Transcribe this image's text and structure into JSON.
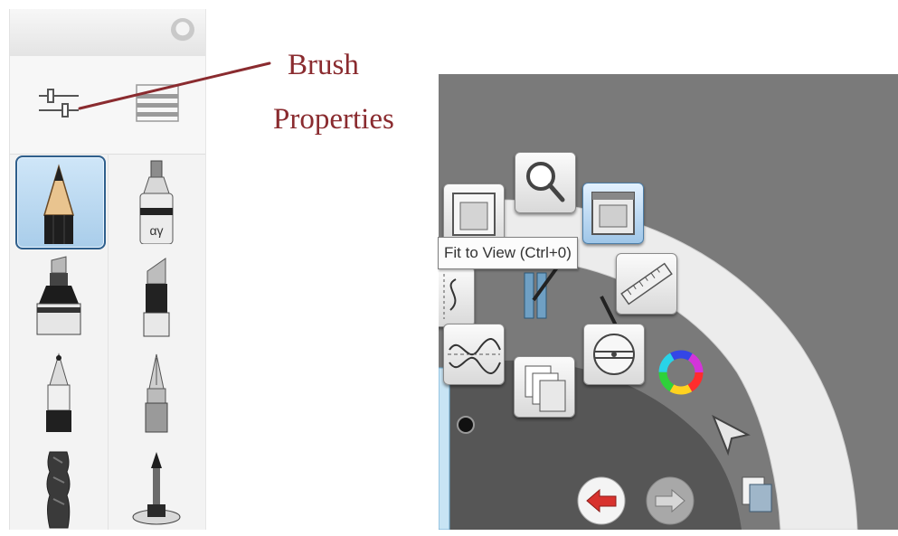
{
  "annotation": {
    "line1": "Brush",
    "line2": "Properties"
  },
  "tooltip": {
    "text": "Fit to View (Ctrl+0)"
  },
  "palette": {
    "tools": [
      "brush-properties",
      "brush-library"
    ],
    "brushes": [
      "pencil",
      "airbrush",
      "marker",
      "chisel-marker",
      "ballpoint-pen",
      "ink-pen",
      "smudge",
      "paint-bucket"
    ],
    "selected_brush": "pencil"
  },
  "menu": {
    "items": [
      "layer-editor",
      "zoom",
      "fit-to-view",
      "symmetry",
      "transform",
      "ruler",
      "french-curve",
      "layers",
      "ellipse-guide",
      "color-wheel",
      "select",
      "copy",
      "undo",
      "redo"
    ],
    "active_item": "fit-to-view"
  },
  "colors": {
    "annotation": "#8a2b2f",
    "canvas": "#7a7a7a",
    "selected": "#a9cdea",
    "undo": "#d8322e"
  }
}
